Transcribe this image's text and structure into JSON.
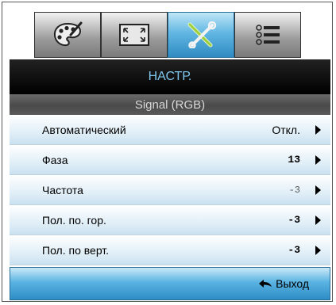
{
  "tabs": [
    {
      "icon": "palette-icon",
      "active": false
    },
    {
      "icon": "screen-icon",
      "active": false
    },
    {
      "icon": "tools-icon",
      "active": true
    },
    {
      "icon": "list-icon",
      "active": false
    }
  ],
  "header": {
    "title": "НАСТР."
  },
  "subheader": {
    "title": "Signal (RGB)"
  },
  "menu": {
    "items": [
      {
        "label": "Автоматический",
        "value": "Откл."
      },
      {
        "label": "Фаза",
        "value": "13"
      },
      {
        "label": "Частота",
        "value": "-3"
      },
      {
        "label": "Пол. по. гор.",
        "value": "-3"
      },
      {
        "label": "Пол. по верт.",
        "value": "-3"
      }
    ]
  },
  "footer": {
    "exit_label": "Выход"
  },
  "colors": {
    "accent": "#3a9ad6",
    "header_text": "#7ec6ee"
  }
}
